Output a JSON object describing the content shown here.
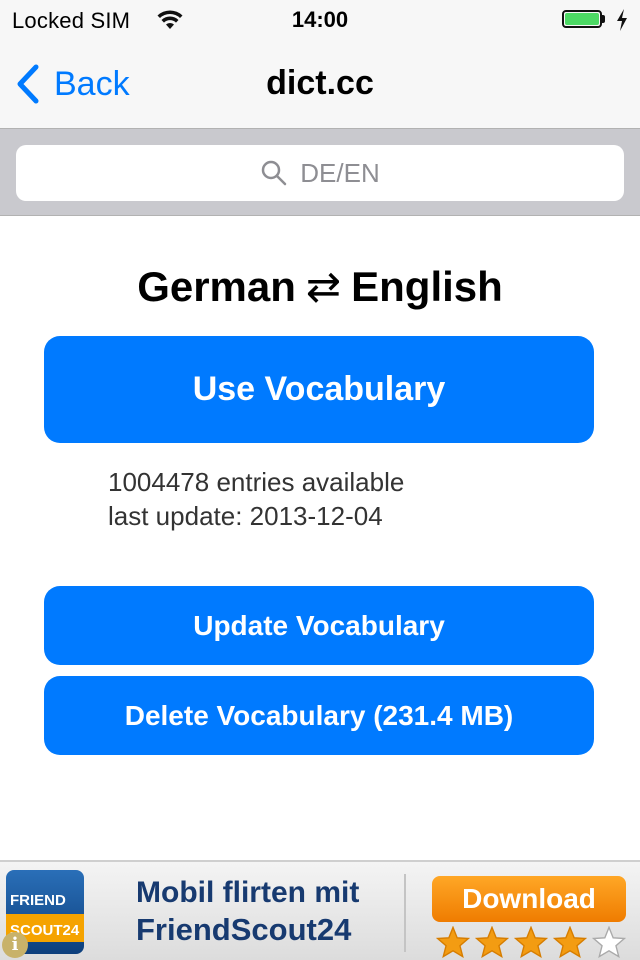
{
  "status_bar": {
    "carrier": "Locked SIM",
    "time": "14:00",
    "battery_level": 1.0,
    "battery_color": "#4cd964"
  },
  "nav": {
    "back_label": "Back",
    "title": "dict.cc"
  },
  "search": {
    "placeholder": "DE/EN",
    "icon": "search-icon"
  },
  "language_pair": {
    "from": "German",
    "swap_symbol": "⇄",
    "to": "English"
  },
  "buttons": {
    "use": "Use Vocabulary",
    "update": "Update Vocabulary",
    "delete": "Delete Vocabulary (231.4 MB)"
  },
  "info": {
    "entries": "1004478 entries available",
    "last_update": "last update: 2013-12-04"
  },
  "ad": {
    "logo_line1": "FRIEND",
    "logo_line2": "SCOUT24",
    "line1": "Mobil flirten mit",
    "line2": "FriendScout24",
    "download_label": "Download",
    "rating": 4,
    "rating_max": 5
  },
  "colors": {
    "accent": "#007aff",
    "nav_background": "#f7f7f7",
    "search_background": "#c9c9ce"
  }
}
